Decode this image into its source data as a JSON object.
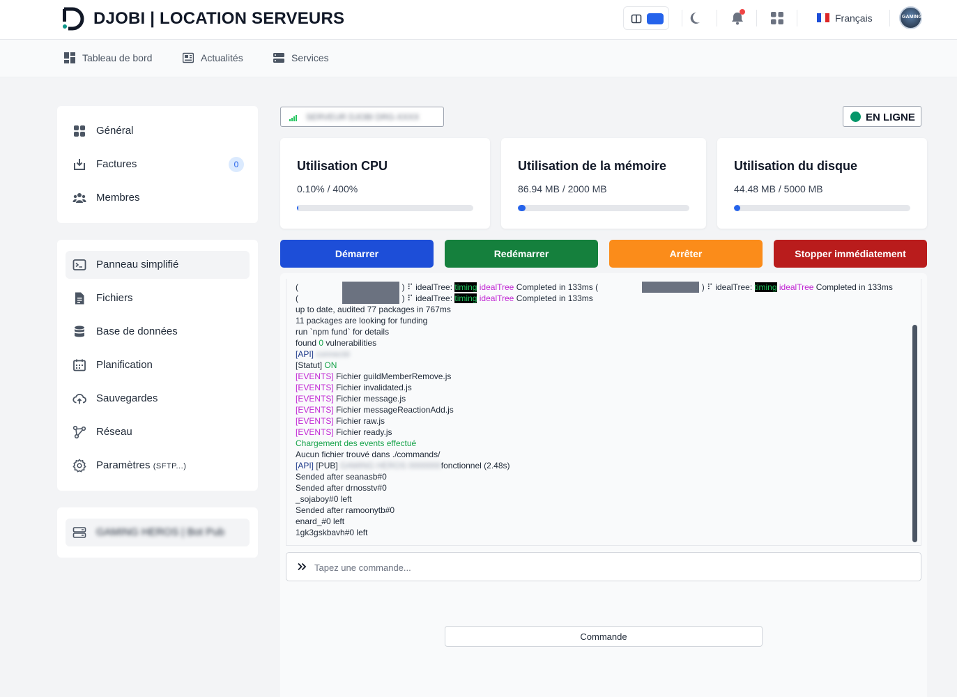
{
  "header": {
    "brand": "DJOBI | LOCATION SERVEURS",
    "language": "Français",
    "avatar_text": "GAMING"
  },
  "nav": {
    "items": [
      {
        "label": "Tableau de bord",
        "icon": "dashboard-icon"
      },
      {
        "label": "Actualités",
        "icon": "newspaper-icon"
      },
      {
        "label": "Services",
        "icon": "server-icon"
      }
    ]
  },
  "sidebar": {
    "account": [
      {
        "label": "Général",
        "icon": "grid-icon"
      },
      {
        "label": "Factures",
        "icon": "download-box-icon",
        "badge": "0"
      },
      {
        "label": "Membres",
        "icon": "users-icon"
      }
    ],
    "server": [
      {
        "label": "Panneau simplifié",
        "icon": "terminal-icon"
      },
      {
        "label": "Fichiers",
        "icon": "file-icon"
      },
      {
        "label": "Base de données",
        "icon": "database-icon"
      },
      {
        "label": "Planification",
        "icon": "calendar-icon"
      },
      {
        "label": "Sauvegardes",
        "icon": "cloud-upload-icon"
      },
      {
        "label": "Réseau",
        "icon": "network-icon"
      },
      {
        "label": "Paramètres",
        "suffix": "(SFTP...)",
        "icon": "gear-icon"
      }
    ],
    "current_server": "GAMING HEROS | Bot Pub"
  },
  "server": {
    "name": "SERVEUR DJOBI DRG-XXXX",
    "status": "EN LIGNE"
  },
  "stats": [
    {
      "title": "Utilisation CPU",
      "value": "0.10% / 400%",
      "fraction": 0.0003
    },
    {
      "title": "Utilisation de la mémoire",
      "value": "86.94 MB / 2000 MB",
      "fraction": 0.043
    },
    {
      "title": "Utilisation du disque",
      "value": "44.48 MB / 5000 MB",
      "fraction": 0.009
    }
  ],
  "actions": {
    "start": "Démarrer",
    "restart": "Redémarrer",
    "stop": "Arrêter",
    "kill": "Stopper immédiatement"
  },
  "colors": {
    "start": "#1d4ed8",
    "restart": "#15803d",
    "stop": "#fb8c1a",
    "kill": "#b91c1c",
    "accent": "#2563eb",
    "online": "#059669"
  },
  "console": {
    "tree_prefix": "idealTree:",
    "timing": "timing",
    "ideal_tree": "idealTree",
    "completed": "Completed in 133ms",
    "lines": {
      "audit": "up to date, audited 77 packages in 767ms",
      "funding": "11 packages are looking for funding",
      "fund": "run `npm fund` for details",
      "vuln_pre": "found",
      "vuln_num": "0",
      "vuln_post": "vulnerabilities",
      "api_tag": "[API]",
      "api_blur": "connecté",
      "statut_tag": "[Statut]",
      "statut_val": "ON",
      "events_tag": "[EVENTS]",
      "ev1": "Fichier guildMemberRemove.js",
      "ev2": "Fichier invalidated.js",
      "ev3": "Fichier message.js",
      "ev4": "Fichier messageReactionAdd.js",
      "ev5": "Fichier raw.js",
      "ev6": "Fichier ready.js",
      "events_done": "Chargement des events effectué",
      "no_cmd": "Aucun fichier trouvé dans ./commands/",
      "pub_tag": "[PUB]",
      "pub_blur": "GAMING HEROS 0000000",
      "pub_ok": "fonctionnel (2.48s)",
      "l1": "Sended after seanasb#0",
      "l2": "Sended after drnosstv#0",
      "l3": "_sojaboy#0 left",
      "l4": "Sended after ramoonytb#0",
      "l5": "enard_#0 left",
      "l6": "1gk3gskbavh#0 left"
    }
  },
  "command": {
    "placeholder": "Tapez une commande...",
    "button": "Commande"
  }
}
